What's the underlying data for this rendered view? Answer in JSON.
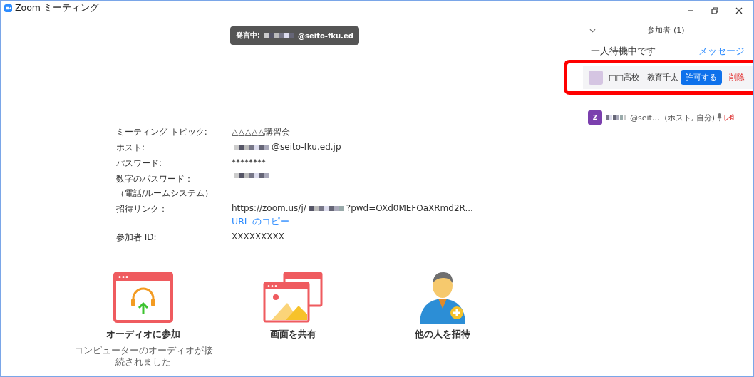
{
  "window": {
    "title": "Zoom ミーティング"
  },
  "speaker_banner": {
    "parts": [
      {
        "kind": "text",
        "text": "発言中:"
      },
      {
        "kind": "mosaic"
      },
      {
        "kind": "text",
        "text": "@seito-fku.ed"
      }
    ]
  },
  "meeting_info": [
    {
      "label_lines": [
        "ミーティング トピック:"
      ],
      "parts": [
        {
          "kind": "text",
          "text": "△△△△△講習会"
        }
      ]
    },
    {
      "label_lines": [
        "ホスト:"
      ],
      "parts": [
        {
          "kind": "mosaic"
        },
        {
          "kind": "text",
          "text": "@seito-fku.ed.jp"
        }
      ]
    },
    {
      "label_lines": [
        "パスワード:"
      ],
      "parts": [
        {
          "kind": "text",
          "text": "********"
        }
      ]
    },
    {
      "label_lines": [
        "数字のパスワード：",
        "（電話/ルームシステム）"
      ],
      "parts": [
        {
          "kind": "mosaic"
        }
      ]
    },
    {
      "label_lines": [
        "招待リンク："
      ],
      "parts": [
        {
          "kind": "text",
          "text": "https://zoom.us/j/"
        },
        {
          "kind": "mosaic"
        },
        {
          "kind": "text",
          "text": "?pwd=OXd0MEFOaXRmd2R..."
        }
      ],
      "link": "URL のコピー"
    },
    {
      "label_lines": [
        "参加者 ID:"
      ],
      "parts": [
        {
          "kind": "text",
          "text": "XXXXXXXXX"
        }
      ]
    }
  ],
  "actions": [
    {
      "kind": "audio",
      "label": "オーディオに参加",
      "note": "コンピューターのオーディオが接続されました"
    },
    {
      "kind": "share",
      "label": "画面を共有"
    },
    {
      "kind": "invite",
      "label": "他の人を招待"
    }
  ],
  "participants_panel": {
    "title": "参加者 (1)",
    "waiting_header": "一人待機中です",
    "message_link": "メッセージ",
    "waiting": [
      {
        "name": "□□高校　教育千太",
        "admit": "許可する",
        "remove": "削除",
        "highlighted": true
      }
    ],
    "in_meeting": [
      {
        "avatar": "Z",
        "parts": [
          {
            "kind": "mosaic"
          },
          {
            "kind": "text",
            "text": "@seit..."
          }
        ],
        "role": "(ホスト, 自分)"
      }
    ]
  }
}
